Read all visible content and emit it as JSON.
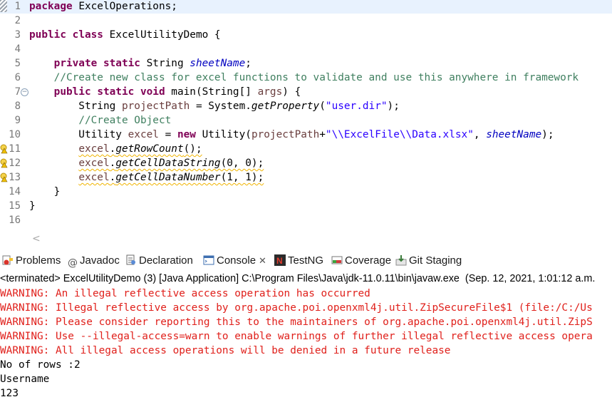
{
  "editor": {
    "lines": [
      {
        "no": "1",
        "code": "package ExcelOperations;"
      },
      {
        "no": "2",
        "code": ""
      },
      {
        "no": "3",
        "code": "public class ExcelUtilityDemo {"
      },
      {
        "no": "4",
        "code": ""
      },
      {
        "no": "5",
        "code": "    private static String sheetName;"
      },
      {
        "no": "6",
        "code": "    //Create new class for excel functions to validate and use this anywhere in framework"
      },
      {
        "no": "7",
        "code": "    public static void main(String[] args) {"
      },
      {
        "no": "8",
        "code": "        String projectPath = System.getProperty(\"user.dir\");"
      },
      {
        "no": "9",
        "code": "        //Create Object"
      },
      {
        "no": "10",
        "code": "        Utility excel = new Utility(projectPath+\"\\\\ExcelFile\\\\Data.xlsx\", sheetName);"
      },
      {
        "no": "11",
        "code": "        excel.getRowCount();"
      },
      {
        "no": "12",
        "code": "        excel.getCellDataString(0, 0);"
      },
      {
        "no": "13",
        "code": "        excel.getCellDataNumber(1, 1);"
      },
      {
        "no": "14",
        "code": "    }"
      },
      {
        "no": "15",
        "code": "}"
      },
      {
        "no": "16",
        "code": ""
      }
    ],
    "warning_lines": [
      11,
      12,
      13
    ],
    "fold_line": 7,
    "fold_glyph": "−",
    "scroll_left_glyph": "<"
  },
  "tabs": [
    {
      "label": "Problems",
      "icon": "problems-icon"
    },
    {
      "label": "Javadoc",
      "icon": "at-sign-icon",
      "glyph": "@"
    },
    {
      "label": "Declaration",
      "icon": "declaration-icon"
    },
    {
      "label": "Console",
      "icon": "console-icon",
      "active": true,
      "close": "✕"
    },
    {
      "label": "TestNG",
      "icon": "testng-icon"
    },
    {
      "label": "Coverage",
      "icon": "coverage-icon"
    },
    {
      "label": "Git Staging",
      "icon": "git-staging-icon"
    }
  ],
  "console": {
    "status": "<terminated> ExcelUtilityDemo (3) [Java Application] C:\\Program Files\\Java\\jdk-11.0.11\\bin\\javaw.exe  (Sep. 12, 2021, 1:01:12 a.m.",
    "lines": [
      {
        "text": "WARNING: An illegal reflective access operation has occurred",
        "type": "err"
      },
      {
        "text": "WARNING: Illegal reflective access by org.apache.poi.openxml4j.util.ZipSecureFile$1 (file:/C:/Us",
        "type": "err"
      },
      {
        "text": "WARNING: Please consider reporting this to the maintainers of org.apache.poi.openxml4j.util.ZipS",
        "type": "err"
      },
      {
        "text": "WARNING: Use --illegal-access=warn to enable warnings of further illegal reflective access opera",
        "type": "err"
      },
      {
        "text": "WARNING: All illegal access operations will be denied in a future release",
        "type": "err"
      },
      {
        "text": "No of rows :2",
        "type": "std"
      },
      {
        "text": "Username",
        "type": "std"
      },
      {
        "text": "123",
        "type": "std"
      }
    ]
  },
  "colors": {
    "keyword": "#7f0055",
    "string": "#2a00ff",
    "comment": "#3f7f5f",
    "field": "#0000c0",
    "error": "#e0201b",
    "current_line": "#e8f2fe"
  }
}
